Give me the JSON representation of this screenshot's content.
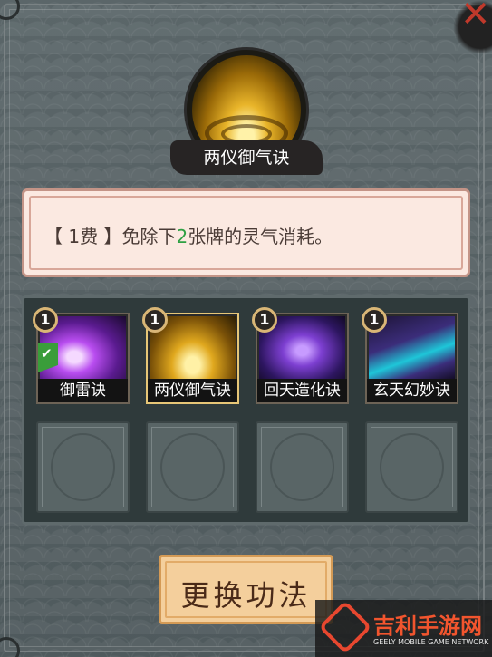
{
  "skill": {
    "name": "两仪御气诀"
  },
  "description": {
    "prefix": "【 1费 】免除下",
    "highlight": "2",
    "suffix": "张牌的灵气消耗。"
  },
  "cards": [
    {
      "cost": "1",
      "name": "御雷诀",
      "equipped": true,
      "icon": "purple-lightning-art"
    },
    {
      "cost": "1",
      "name": "两仪御气诀",
      "selected": true,
      "icon": "gold-yin-yang-art"
    },
    {
      "cost": "1",
      "name": "回天造化诀",
      "icon": "purple-meditating-figure-art"
    },
    {
      "cost": "1",
      "name": "玄天幻妙诀",
      "icon": "cyan-blade-art"
    }
  ],
  "empty_slots": 4,
  "change_button": {
    "label": "更换功法"
  },
  "watermark": {
    "main": "吉利手游网",
    "sub": "GEELY MOBILE GAME NETWORK"
  },
  "colors": {
    "highlight": "#2ea043",
    "close": "#c0392b",
    "watermark": "#f2552e"
  }
}
